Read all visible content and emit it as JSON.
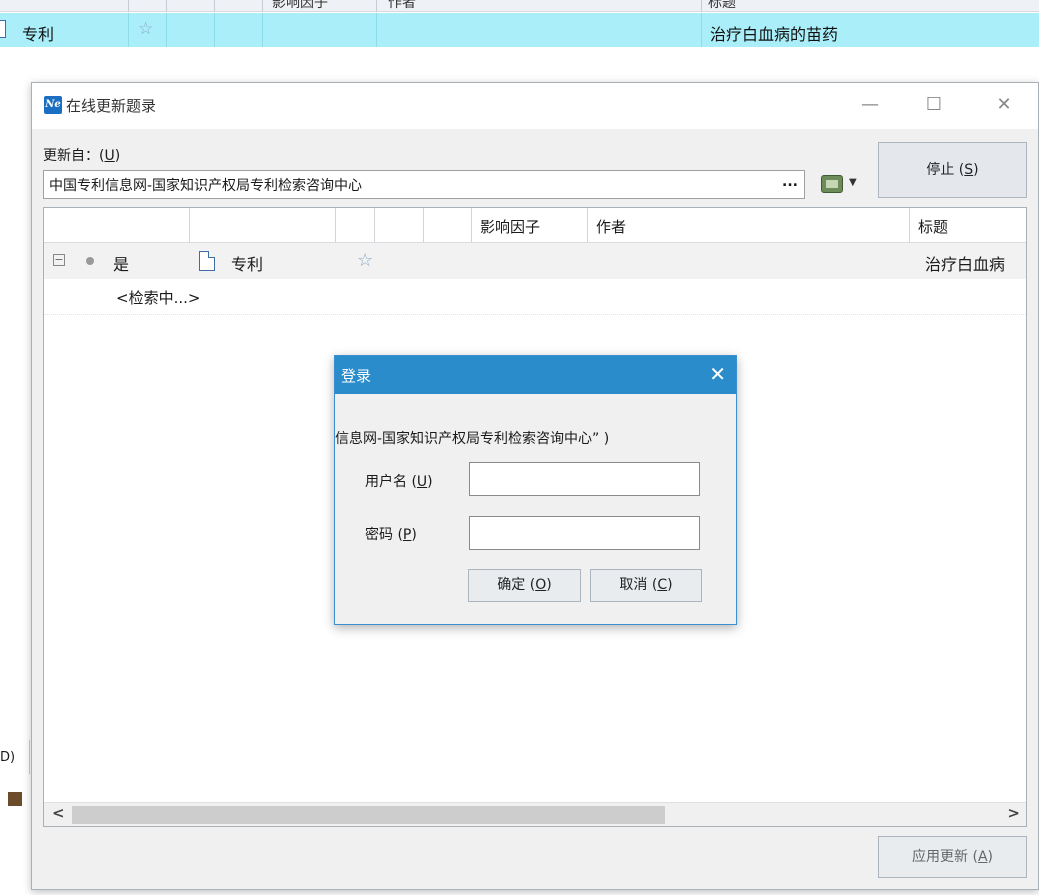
{
  "background_list": {
    "header": {
      "col1": "影响因子",
      "col2": "作者",
      "col3": "标题"
    },
    "row": {
      "type": "专利",
      "title": "治疗白血病的苗药"
    },
    "left_panel_text": "D)"
  },
  "dialog": {
    "title": "在线更新题录",
    "app_icon_text": "Ne",
    "window_controls": {
      "minimize": "—",
      "maximize": "☐",
      "close": "✕"
    },
    "update_from_label": "更新自：(U)",
    "source_value": "中国专利信息网-国家知识产权局专利检索咨询中心",
    "source_browse": "...",
    "stop_button": "停止 (S)",
    "apply_button": "应用更新 (A)",
    "results": {
      "columns": [
        "影响因子",
        "作者",
        "标题"
      ],
      "row1": {
        "expand": "⊟",
        "status": "是",
        "type": "专利",
        "star": "☆",
        "title": "治疗白血病"
      },
      "row2": {
        "text": "<检索中...>"
      }
    },
    "scroll": {
      "left": "<",
      "right": ">"
    }
  },
  "login": {
    "title": "登录",
    "close": "✕",
    "message": "信息网-国家知识产权局专利检索咨询中心”  )",
    "username_label": "用户名 (U)",
    "password_label": "密码 (P)",
    "username_value": "",
    "password_value": "",
    "ok_button": "确定 (O)",
    "cancel_button": "取消 (C)"
  }
}
